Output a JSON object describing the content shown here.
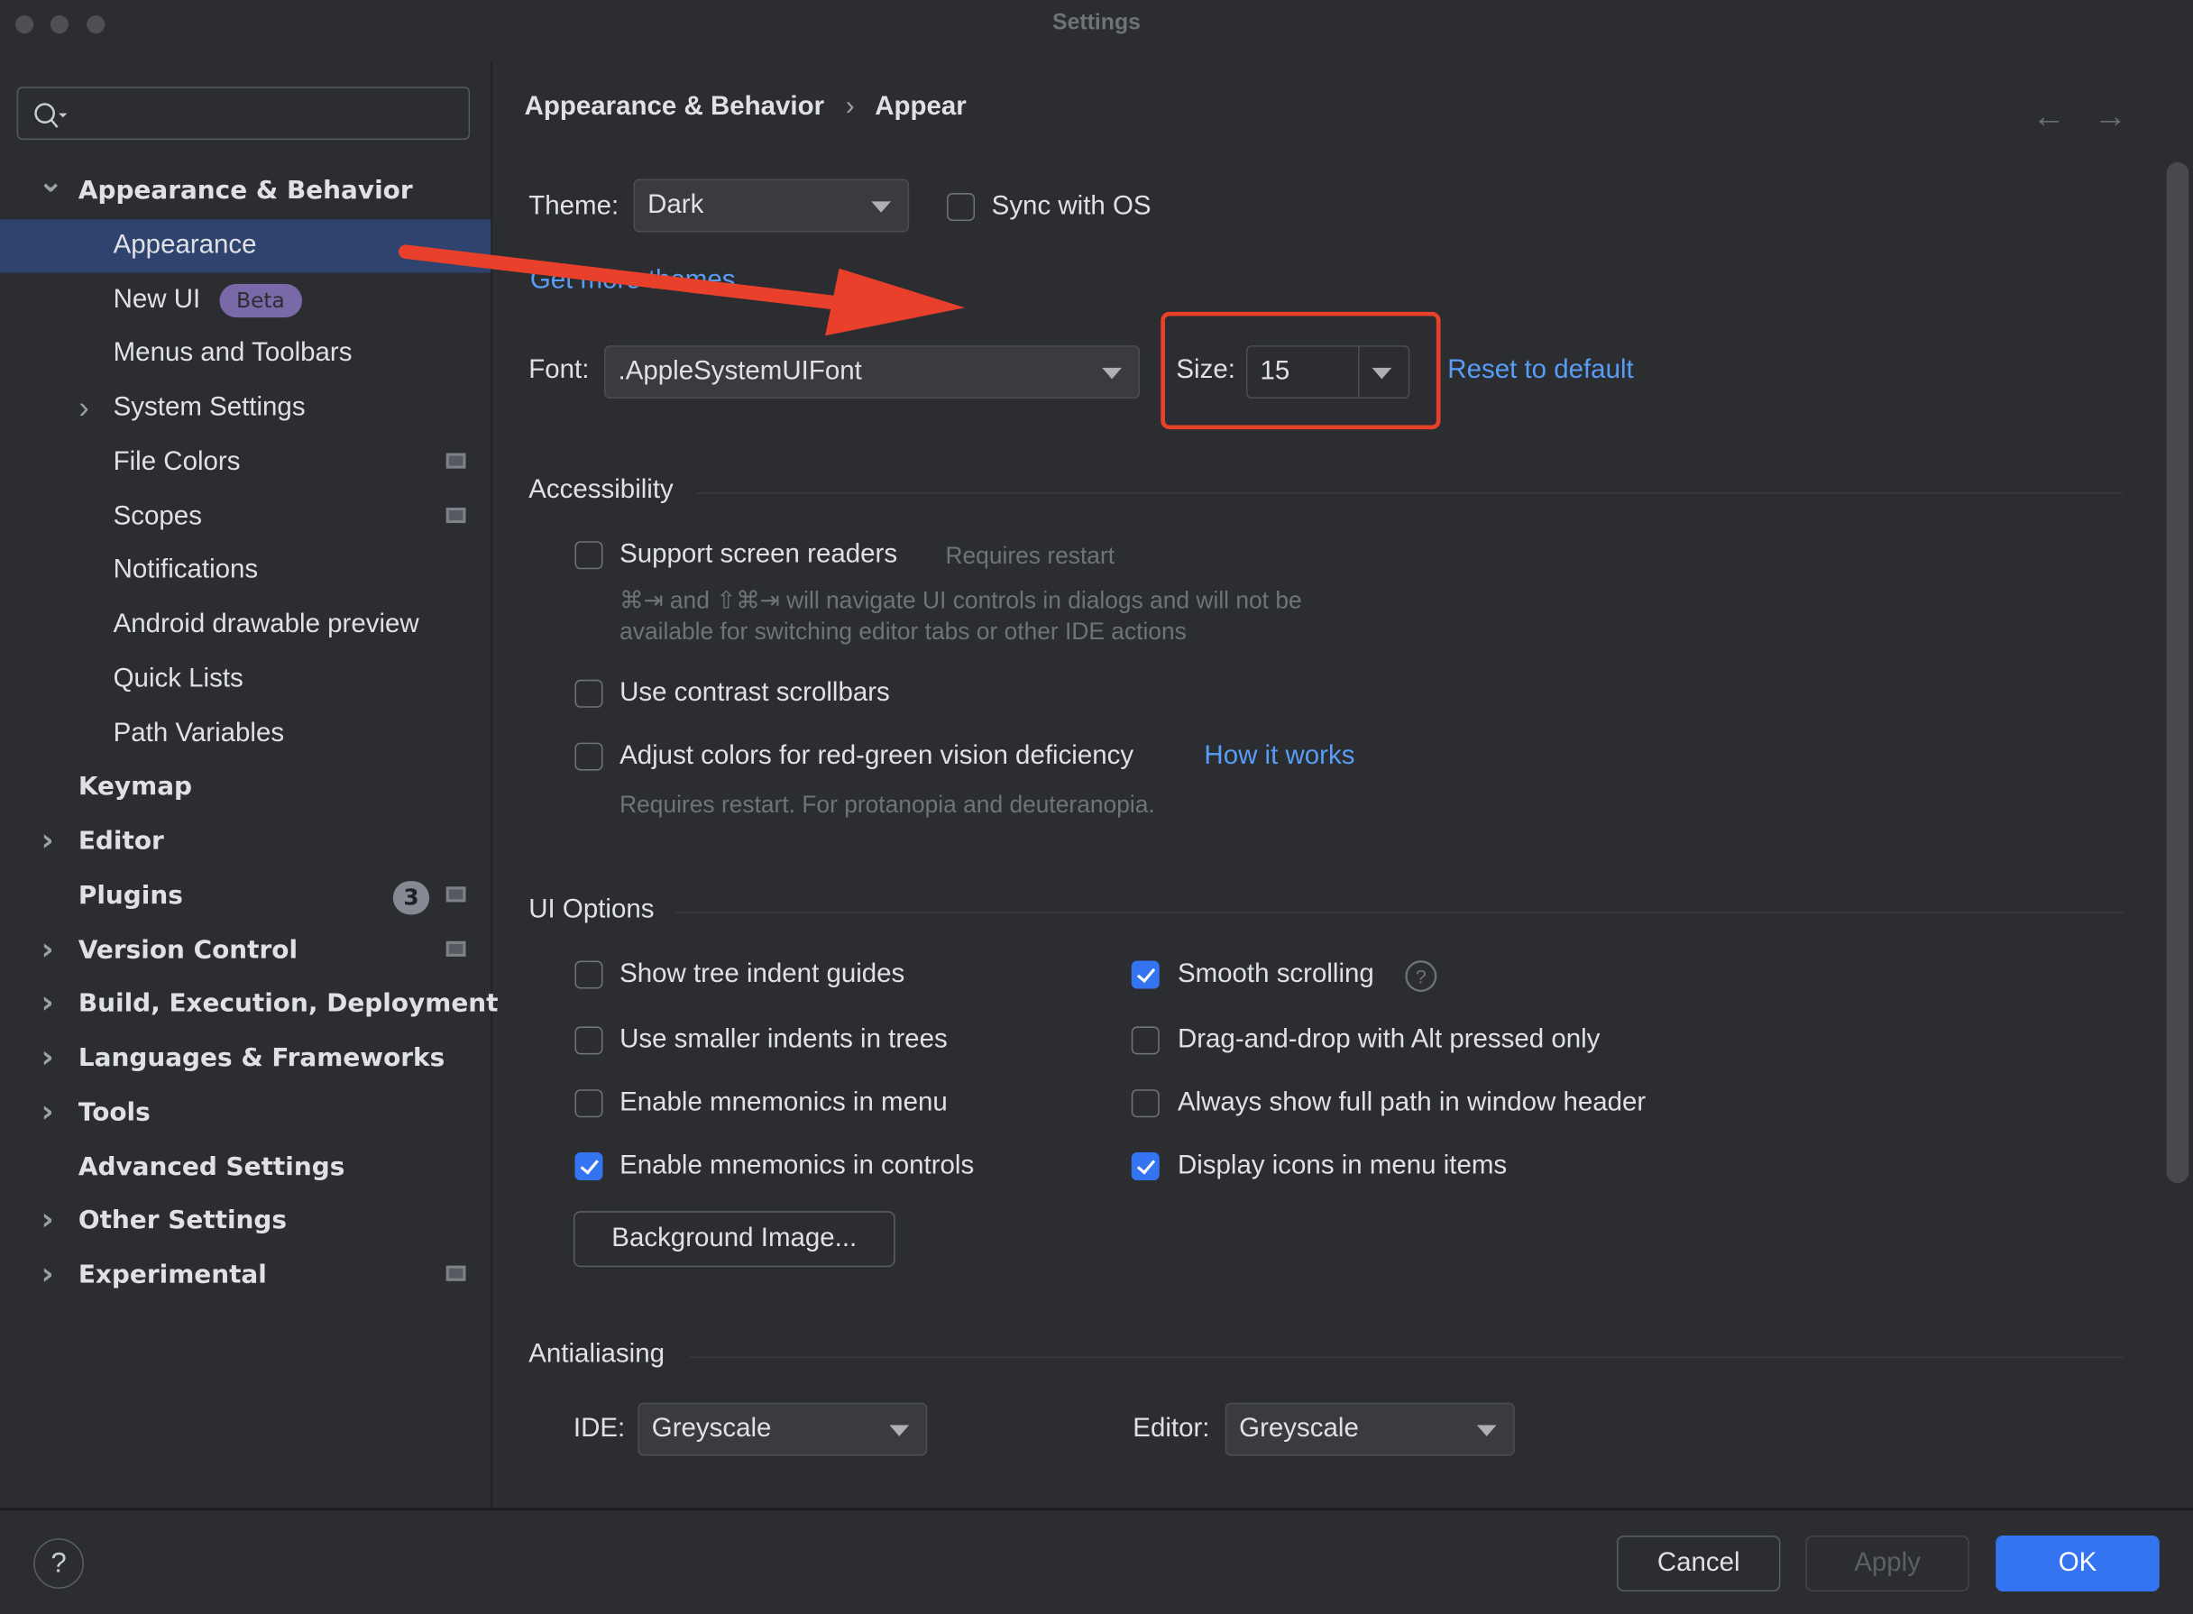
{
  "window": {
    "title": "Settings",
    "traffic_lights": [
      "close",
      "minimize",
      "zoom"
    ]
  },
  "sidebar": {
    "search": {
      "placeholder": "",
      "value": "",
      "icon": "search-icon"
    },
    "items": [
      {
        "label": "Appearance & Behavior",
        "level": 0,
        "bold": true,
        "expand": "expanded"
      },
      {
        "label": "Appearance",
        "level": 1,
        "selected": true
      },
      {
        "label": "New UI",
        "level": 1,
        "badge": "Beta"
      },
      {
        "label": "Menus and Toolbars",
        "level": 1
      },
      {
        "label": "System Settings",
        "level": 1,
        "expand": "collapsed"
      },
      {
        "label": "File Colors",
        "level": 1,
        "project_icon": true
      },
      {
        "label": "Scopes",
        "level": 1,
        "project_icon": true
      },
      {
        "label": "Notifications",
        "level": 1
      },
      {
        "label": "Android drawable preview",
        "level": 1
      },
      {
        "label": "Quick Lists",
        "level": 1
      },
      {
        "label": "Path Variables",
        "level": 1
      },
      {
        "label": "Keymap",
        "level": 0,
        "bold": true
      },
      {
        "label": "Editor",
        "level": 0,
        "bold": true,
        "expand": "collapsed"
      },
      {
        "label": "Plugins",
        "level": 0,
        "bold": true,
        "count": "3",
        "project_icon": true
      },
      {
        "label": "Version Control",
        "level": 0,
        "bold": true,
        "expand": "collapsed",
        "project_icon": true
      },
      {
        "label": "Build, Execution, Deployment",
        "level": 0,
        "bold": true,
        "expand": "collapsed"
      },
      {
        "label": "Languages & Frameworks",
        "level": 0,
        "bold": true,
        "expand": "collapsed"
      },
      {
        "label": "Tools",
        "level": 0,
        "bold": true,
        "expand": "collapsed"
      },
      {
        "label": "Advanced Settings",
        "level": 0,
        "bold": true
      },
      {
        "label": "Other Settings",
        "level": 0,
        "bold": true,
        "expand": "collapsed"
      },
      {
        "label": "Experimental",
        "level": 0,
        "bold": true,
        "expand": "collapsed",
        "project_icon": true
      }
    ]
  },
  "breadcrumb": {
    "parent": "Appearance & Behavior",
    "separator": "›",
    "current": "Appear"
  },
  "nav": {
    "back": "←",
    "forward": "→"
  },
  "appearance": {
    "theme_label": "Theme:",
    "theme_value": "Dark",
    "sync_os_label": "Sync with OS",
    "sync_os_checked": false,
    "get_more_themes": "Get more themes",
    "font_label": "Font:",
    "font_value": ".AppleSystemUIFont",
    "size_label": "Size:",
    "size_value": "15",
    "reset_link": "Reset to default"
  },
  "accessibility": {
    "title": "Accessibility",
    "screen_readers": {
      "label": "Support screen readers",
      "checked": false,
      "note": "Requires restart",
      "help": "⌘⇥ and ⇧⌘⇥ will navigate UI controls in dialogs and will not be",
      "help2": "available for switching editor tabs or other IDE actions"
    },
    "contrast_scrollbars": {
      "label": "Use contrast scrollbars",
      "checked": false
    },
    "color_deficiency": {
      "label": "Adjust colors for red-green vision deficiency",
      "checked": false,
      "link": "How it works",
      "note": "Requires restart. For protanopia and deuteranopia."
    }
  },
  "ui_options": {
    "title": "UI Options",
    "left": [
      {
        "label": "Show tree indent guides",
        "checked": false
      },
      {
        "label": "Use smaller indents in trees",
        "checked": false
      },
      {
        "label": "Enable mnemonics in menu",
        "checked": false
      },
      {
        "label": "Enable mnemonics in controls",
        "checked": true
      }
    ],
    "right": [
      {
        "label": "Smooth scrolling",
        "checked": true,
        "help_icon": true
      },
      {
        "label": "Drag-and-drop with Alt pressed only",
        "checked": false
      },
      {
        "label": "Always show full path in window header",
        "checked": false
      },
      {
        "label": "Display icons in menu items",
        "checked": true
      }
    ],
    "background_image_button": "Background Image..."
  },
  "antialiasing": {
    "title": "Antialiasing",
    "ide_label": "IDE:",
    "ide_value": "Greyscale",
    "editor_label": "Editor:",
    "editor_value": "Greyscale"
  },
  "footer": {
    "help": "?",
    "cancel": "Cancel",
    "apply": "Apply",
    "ok": "OK"
  },
  "colors": {
    "accent": "#3574f0",
    "link": "#589df6",
    "annotation": "#e8402a",
    "selection": "#2e436e",
    "background": "#2b2d30"
  }
}
